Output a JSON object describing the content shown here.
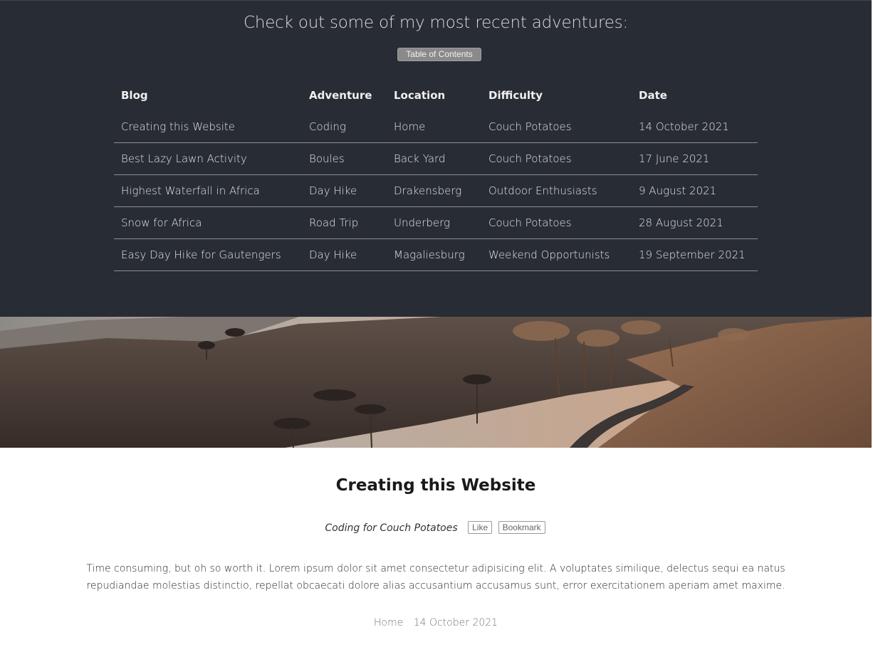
{
  "header": {
    "title": "Check out some of my most recent adventures:",
    "toc_button": "Table of Contents"
  },
  "table": {
    "columns": [
      "Blog",
      "Adventure",
      "Location",
      "Difficulty",
      "Date"
    ],
    "rows": [
      [
        "Creating this Website",
        "Coding",
        "Home",
        "Couch Potatoes",
        "14 October 2021"
      ],
      [
        "Best Lazy Lawn Activity",
        "Boules",
        "Back Yard",
        "Couch Potatoes",
        "17 June 2021"
      ],
      [
        "Highest Waterfall in Africa",
        "Day Hike",
        "Drakensberg",
        "Outdoor Enthusiasts",
        "9 August 2021"
      ],
      [
        "Snow for Africa",
        "Road Trip",
        "Underberg",
        "Couch Potatoes",
        "28 August 2021"
      ],
      [
        "Easy Day Hike for Gautengers",
        "Day Hike",
        "Magaliesburg",
        "Weekend Opportunists",
        "19 September 2021"
      ]
    ]
  },
  "post": {
    "title": "Creating this Website",
    "category": "Coding for Couch Potatoes",
    "like_label": "Like",
    "bookmark_label": "Bookmark",
    "body": "Time consuming, but oh so worth it. Lorem ipsum dolor sit amet consectetur adipisicing elit. A voluptates similique, delectus sequi ea natus repudiandae molestias distinctio, repellat obcaecati dolore alias accusantium accusamus sunt, error exercitationem aperiam amet maxime.",
    "location": "Home",
    "date": "14 October 2021"
  }
}
